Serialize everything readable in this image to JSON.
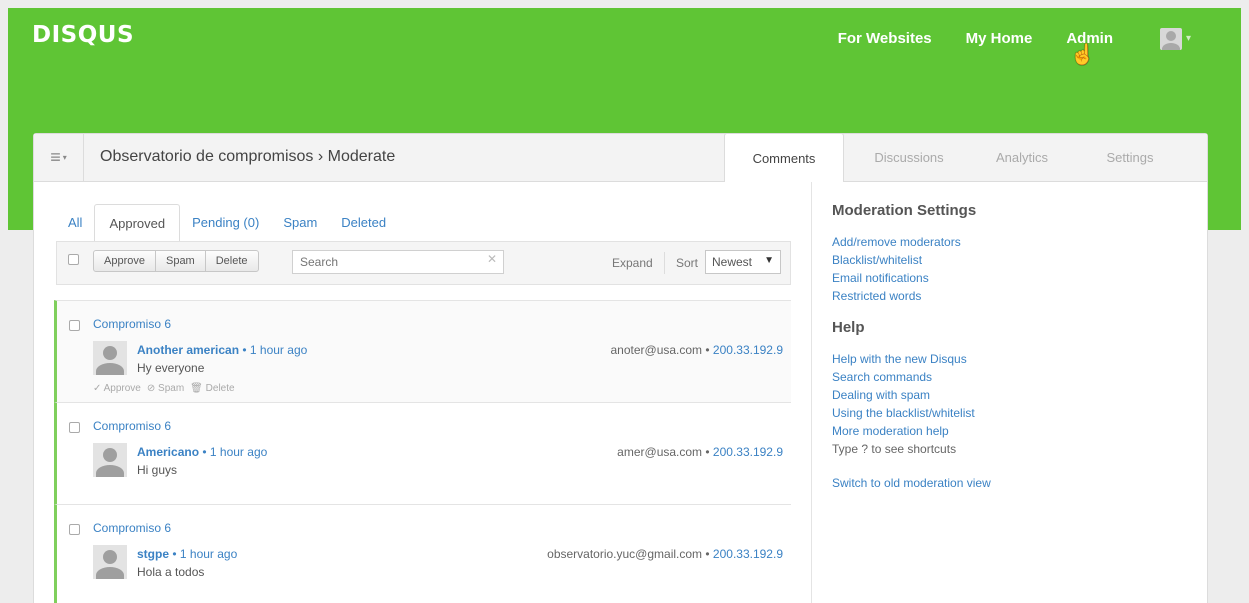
{
  "brand": {
    "logo": "DISQUS",
    "green": "#5fc535"
  },
  "topnav": {
    "for_websites": "For Websites",
    "my_home": "My Home",
    "admin": "Admin"
  },
  "header": {
    "title": "Observatorio de compromisos › Moderate"
  },
  "main_tabs": [
    "Comments",
    "Discussions",
    "Analytics",
    "Settings"
  ],
  "sub_tabs": [
    "All",
    "Approved",
    "Pending (0)",
    "Spam",
    "Deleted"
  ],
  "toolbar": {
    "approve": "Approve",
    "spam": "Spam",
    "delete": "Delete",
    "search_placeholder": "Search",
    "expand": "Expand",
    "sort_label": "Sort",
    "sort_value": "Newest"
  },
  "comments": [
    {
      "discussion": "Compromiso 6",
      "author": "Another american",
      "time": "1 hour ago",
      "text": "Hy everyone",
      "email": "anoter@usa.com",
      "ip": "200.33.192.9",
      "actions": {
        "approve": "Approve",
        "spam": "Spam",
        "delete": "Delete"
      }
    },
    {
      "discussion": "Compromiso 6",
      "author": "Americano",
      "time": "1 hour ago",
      "text": "Hi guys",
      "email": "amer@usa.com",
      "ip": "200.33.192.9"
    },
    {
      "discussion": "Compromiso 6",
      "author": "stgpe",
      "time": "1 hour ago",
      "text": "Hola a todos",
      "email": "observatorio.yuc@gmail.com",
      "ip": "200.33.192.9"
    }
  ],
  "sidebar": {
    "moderation_title": "Moderation Settings",
    "moderation_links": [
      "Add/remove moderators",
      "Blacklist/whitelist",
      "Email notifications",
      "Restricted words"
    ],
    "help_title": "Help",
    "help_links": [
      "Help with the new Disqus",
      "Search commands",
      "Dealing with spam",
      "Using the blacklist/whitelist",
      "More moderation help"
    ],
    "shortcut_text": "Type  ?  to see shortcuts",
    "switch_link": "Switch to old moderation view"
  }
}
